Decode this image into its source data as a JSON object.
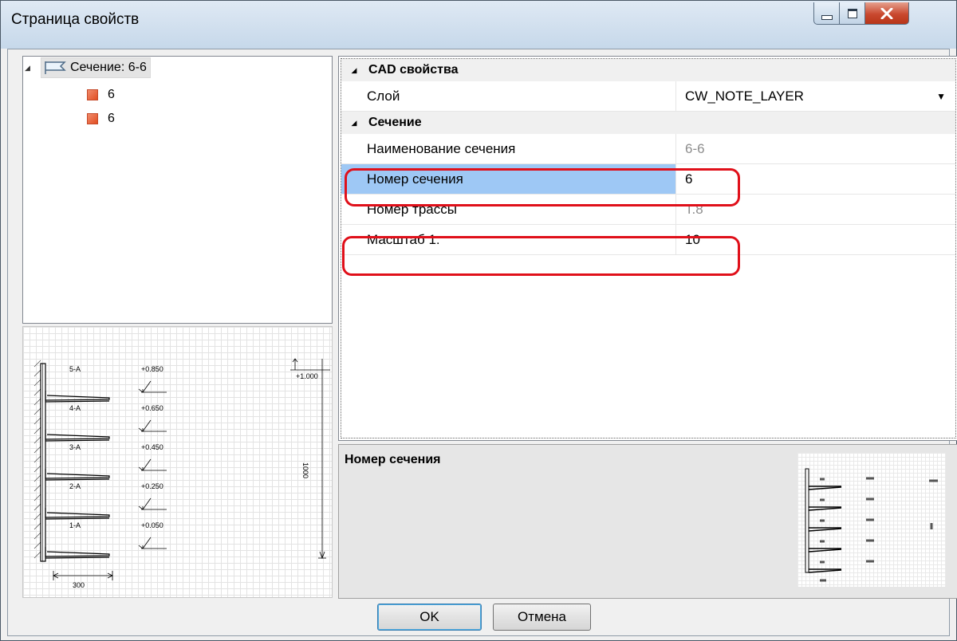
{
  "window": {
    "title": "Страница свойств"
  },
  "tree": {
    "root": {
      "label": "Сечение: 6-6",
      "icon": "section-icon"
    },
    "children": [
      {
        "label": "6",
        "icon": "square-icon",
        "color": "#e8532b"
      },
      {
        "label": "6",
        "icon": "square-icon",
        "color": "#e8532b"
      }
    ]
  },
  "preview": {
    "tiers": [
      {
        "label": "5-A",
        "elevation": "+0.850"
      },
      {
        "label": "4-A",
        "elevation": "+0.650"
      },
      {
        "label": "3-A",
        "elevation": "+0.450"
      },
      {
        "label": "2-A",
        "elevation": "+0.250"
      },
      {
        "label": "1-A",
        "elevation": "+0.050"
      }
    ],
    "top_elevation": "+1.000",
    "height_dim": "1000",
    "width_dim": "300"
  },
  "properties": {
    "categories": [
      {
        "name": "CAD свойства",
        "rows": [
          {
            "name": "Слой",
            "value": "CW_NOTE_LAYER",
            "dropdown": true
          }
        ]
      },
      {
        "name": "Сечение",
        "rows": [
          {
            "name": "Наименование сечения",
            "value": "6-6",
            "readonly": true
          },
          {
            "name": "Номер сечения",
            "value": "6",
            "selected": true
          },
          {
            "name": "Номер трассы",
            "value": "Т.8",
            "readonly": true
          },
          {
            "name": "Масштаб 1:",
            "value": "10"
          }
        ]
      }
    ]
  },
  "description": {
    "title": "Номер сечения"
  },
  "buttons": {
    "ok": "OK",
    "cancel": "Отмена"
  },
  "colors": {
    "highlight": "#e0101a",
    "selection": "#9ec8f5",
    "accent": "#e8532b"
  }
}
